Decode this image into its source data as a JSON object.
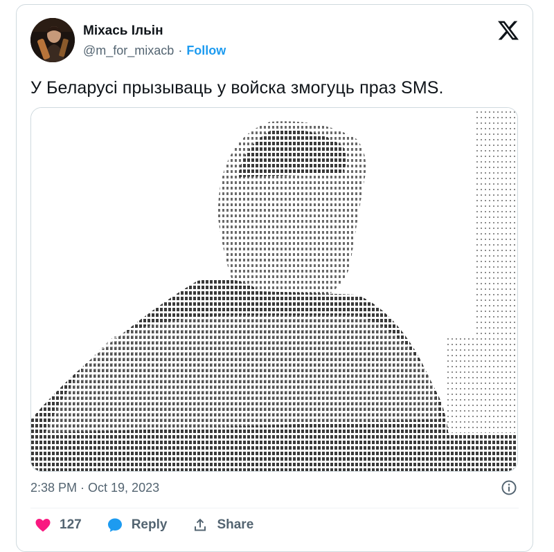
{
  "author": {
    "name": "Міхась Ільін",
    "handle": "@m_for_mixacb",
    "separator": "·",
    "follow_label": "Follow"
  },
  "tweet": {
    "text": "У Беларусі прызываць у войска змогуць праз SMS."
  },
  "meta": {
    "timestamp": "2:38 PM · Oct 19, 2023"
  },
  "actions": {
    "like_count": "127",
    "reply_label": "Reply",
    "share_label": "Share"
  },
  "colors": {
    "accent": "#1d9bf0",
    "like": "#f91880",
    "text_secondary": "#536471",
    "border": "#cfd9de"
  },
  "icons": [
    "x-logo-icon",
    "info-icon",
    "heart-icon",
    "reply-bubble-icon",
    "share-icon"
  ],
  "media": {
    "kind": "ascii-art-image"
  }
}
